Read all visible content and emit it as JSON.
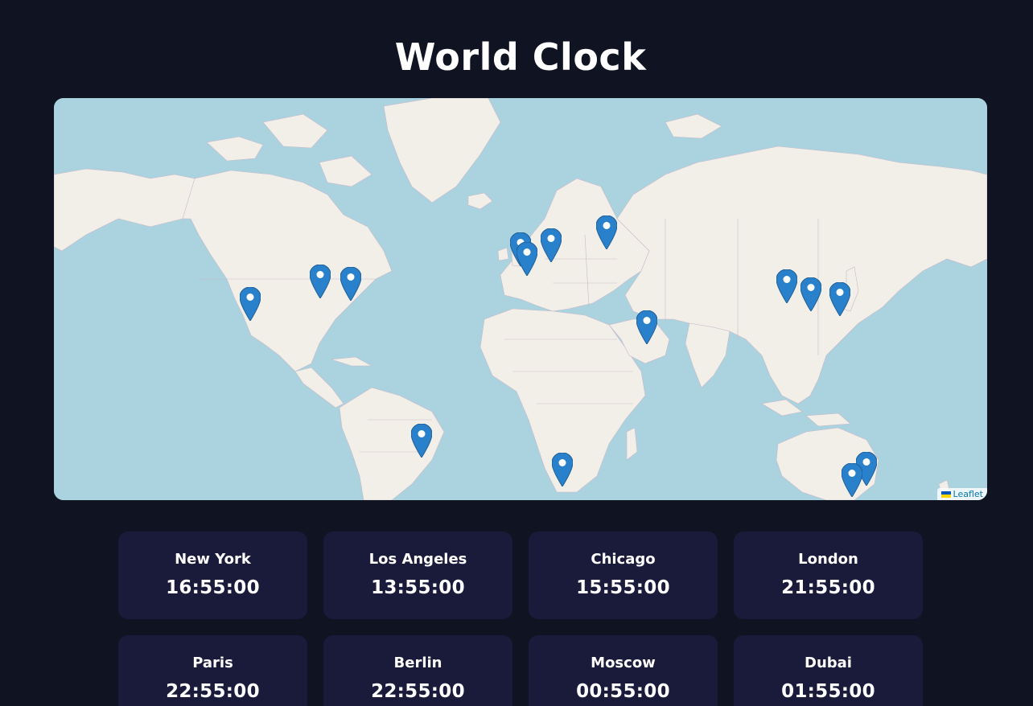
{
  "header": {
    "title": "World Clock"
  },
  "map": {
    "attribution": "Leaflet",
    "marker_icon": "map-pin-icon",
    "marker_color": "#2a81cb",
    "water_color": "#aad3df",
    "land_color": "#f2efe9"
  },
  "clocks": [
    {
      "city": "New York",
      "time": "16:55:00"
    },
    {
      "city": "Los Angeles",
      "time": "13:55:00"
    },
    {
      "city": "Chicago",
      "time": "15:55:00"
    },
    {
      "city": "London",
      "time": "21:55:00"
    },
    {
      "city": "Paris",
      "time": "22:55:00"
    },
    {
      "city": "Berlin",
      "time": "22:55:00"
    },
    {
      "city": "Moscow",
      "time": "00:55:00"
    },
    {
      "city": "Dubai",
      "time": "01:55:00"
    }
  ]
}
